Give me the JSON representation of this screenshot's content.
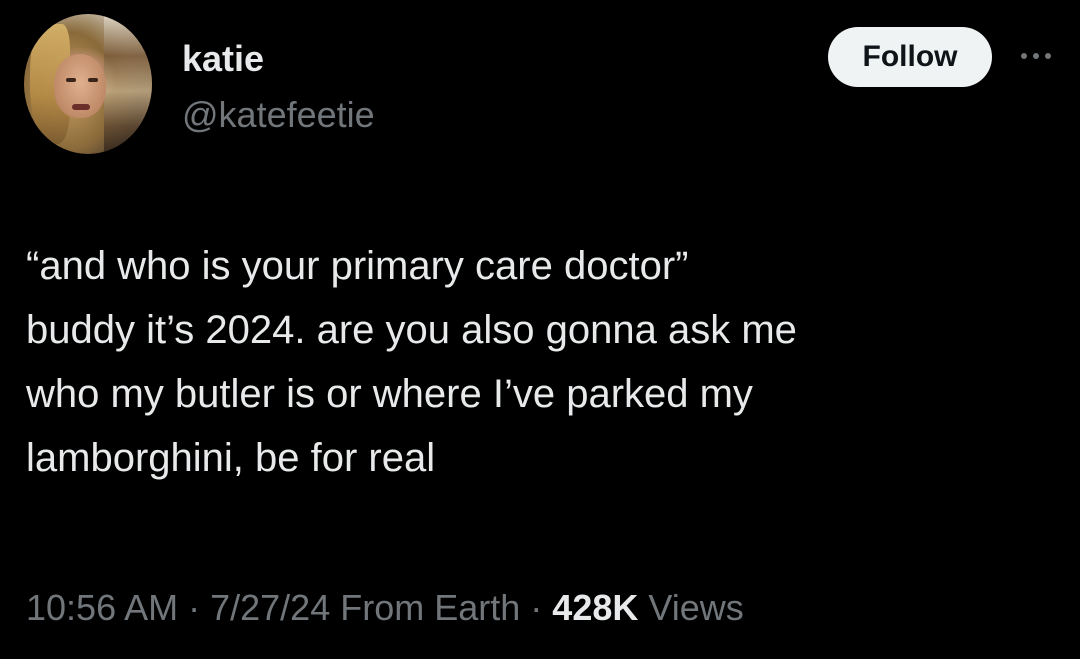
{
  "author": {
    "display_name": "katie",
    "handle": "@katefeetie"
  },
  "actions": {
    "follow_label": "Follow",
    "more_icon": "more-horizontal-icon"
  },
  "tweet": {
    "lines": [
      "“and who is your primary care doctor”",
      "buddy it’s 2024. are you also gonna ask me",
      "who my butler is or where I’ve parked my",
      "lamborghini, be for real"
    ]
  },
  "meta": {
    "time": "10:56 AM",
    "separator": " · ",
    "date": "7/27/24",
    "source": "From Earth",
    "views_count": "428K",
    "views_label": "Views"
  },
  "colors": {
    "background": "#000000",
    "text_primary": "#e7e9ea",
    "text_secondary": "#71767b",
    "follow_bg": "#eff3f4",
    "follow_text": "#0f1419"
  }
}
